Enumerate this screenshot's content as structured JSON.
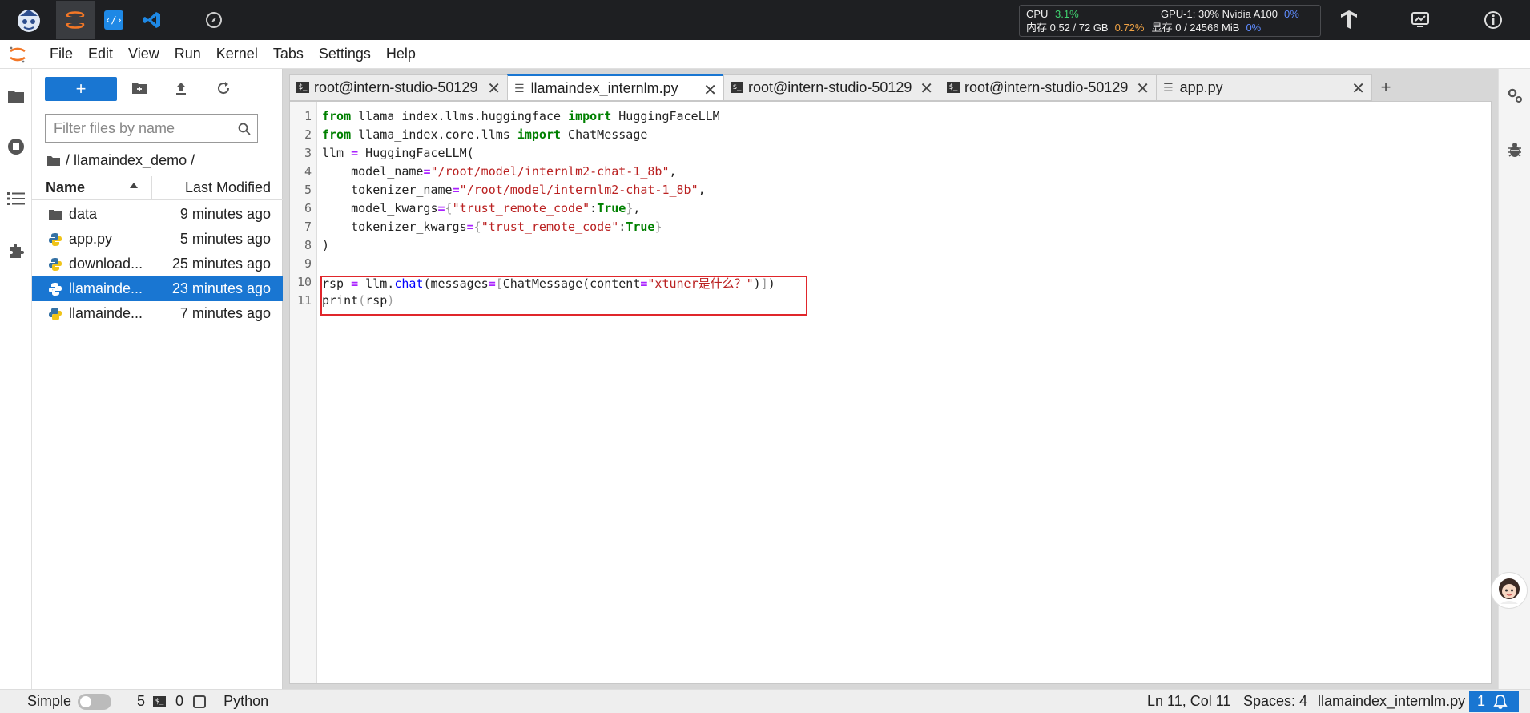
{
  "topbar": {
    "cpu_label": "CPU",
    "cpu_value": "3.1%",
    "mem_label": "内存 0.52 / 72 GB",
    "mem_pct": "0.72%",
    "gpu_label": "GPU-1: 30% Nvidia A100",
    "gpu_pct": "0%",
    "vram_label": "显存 0 / 24566 MiB",
    "vram_pct": "0%"
  },
  "menu": [
    "File",
    "Edit",
    "View",
    "Run",
    "Kernel",
    "Tabs",
    "Settings",
    "Help"
  ],
  "filebrowser": {
    "new_button": "+",
    "filter_placeholder": "Filter files by name",
    "breadcrumb": "/ llamaindex_demo /",
    "col_name": "Name",
    "col_modified": "Last Modified",
    "files": [
      {
        "name": "data",
        "modified": "9 minutes ago",
        "type": "folder"
      },
      {
        "name": "app.py",
        "modified": "5 minutes ago",
        "type": "python"
      },
      {
        "name": "download...",
        "modified": "25 minutes ago",
        "type": "python"
      },
      {
        "name": "llamainde...",
        "modified": "23 minutes ago",
        "type": "python",
        "selected": true
      },
      {
        "name": "llamainde...",
        "modified": "7 minutes ago",
        "type": "python"
      }
    ]
  },
  "tabs": [
    {
      "label": "root@intern-studio-50129",
      "type": "terminal"
    },
    {
      "label": "llamaindex_internlm.py",
      "type": "file",
      "active": true
    },
    {
      "label": "root@intern-studio-50129",
      "type": "terminal"
    },
    {
      "label": "root@intern-studio-50129",
      "type": "terminal"
    },
    {
      "label": "app.py",
      "type": "file"
    }
  ],
  "add_tab": "+",
  "editor": {
    "line_numbers": [
      "1",
      "2",
      "3",
      "4",
      "5",
      "6",
      "7",
      "8",
      "9",
      "10",
      "11"
    ]
  },
  "code": {
    "l1": {
      "kw1": "from",
      "mod": " llama_index.llms.huggingface ",
      "kw2": "import",
      "name": " HuggingFaceLLM"
    },
    "l2": {
      "kw1": "from",
      "mod": " llama_index.core.llms ",
      "kw2": "import",
      "name": " ChatMessage"
    },
    "l3": {
      "a": "llm ",
      "op": "=",
      "b": " HuggingFaceLLM("
    },
    "l4": {
      "a": "    model_name",
      "op": "=",
      "s": "\"/root/model/internlm2-chat-1_8b\"",
      "b": ","
    },
    "l5": {
      "a": "    tokenizer_name",
      "op": "=",
      "s": "\"/root/model/internlm2-chat-1_8b\"",
      "b": ","
    },
    "l6": {
      "a": "    model_kwargs",
      "op": "=",
      "br1": "{",
      "s": "\"trust_remote_code\"",
      "c": ":",
      "kw": "True",
      "br2": "}",
      "b": ","
    },
    "l7": {
      "a": "    tokenizer_kwargs",
      "op": "=",
      "br1": "{",
      "s": "\"trust_remote_code\"",
      "c": ":",
      "kw": "True",
      "br2": "}"
    },
    "l8": {
      "a": ")"
    },
    "l10": {
      "a": "rsp ",
      "op": "=",
      "b": " llm.",
      "fn": "chat",
      "c": "(messages",
      "op2": "=",
      "br1": "[",
      "d": "ChatMessage(content",
      "op3": "=",
      "s": "\"xtuner是什么？\"",
      "e": ")",
      "br2": "]",
      "f": ")"
    },
    "l11": {
      "a": "print",
      "br1": "(",
      "b": "rsp",
      "br2": ")"
    }
  },
  "status": {
    "mode": "Simple",
    "kernels": "5",
    "terminals": "0",
    "kernel_name": "Python",
    "position": "Ln 11, Col 11",
    "spaces": "Spaces: 4",
    "filename": "llamaindex_internlm.py",
    "notifications": "1"
  }
}
